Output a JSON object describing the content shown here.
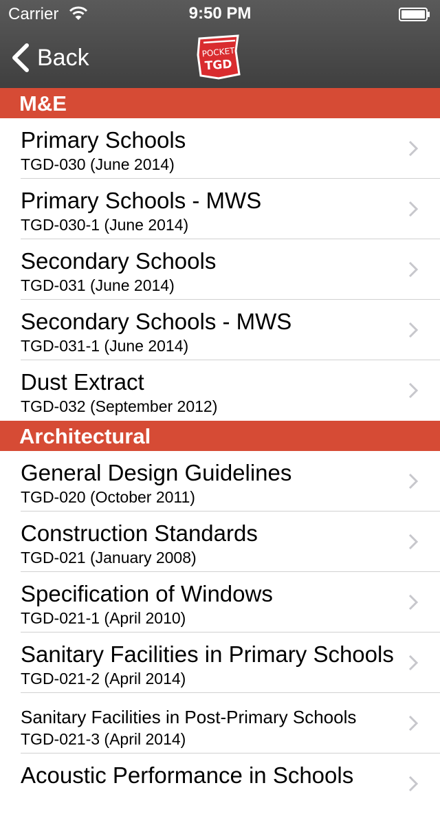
{
  "status": {
    "carrier": "Carrier",
    "time": "9:50 PM"
  },
  "nav": {
    "back_label": "Back",
    "logo_text_1": "POCKET",
    "logo_text_2": "TGD"
  },
  "colors": {
    "accent": "#d64b35",
    "navbar": "#4f4f4f"
  },
  "sections": [
    {
      "header": "M&E",
      "items": [
        {
          "title": "Primary Schools",
          "subtitle": "TGD-030 (June 2014)"
        },
        {
          "title": "Primary Schools - MWS",
          "subtitle": "TGD-030-1 (June 2014)"
        },
        {
          "title": "Secondary Schools",
          "subtitle": "TGD-031 (June 2014)"
        },
        {
          "title": "Secondary Schools - MWS",
          "subtitle": "TGD-031-1 (June 2014)"
        },
        {
          "title": "Dust Extract",
          "subtitle": "TGD-032 (September 2012)"
        }
      ]
    },
    {
      "header": "Architectural",
      "items": [
        {
          "title": "General Design Guidelines",
          "subtitle": "TGD-020 (October 2011)"
        },
        {
          "title": "Construction Standards",
          "subtitle": "TGD-021 (January 2008)"
        },
        {
          "title": "Specification of Windows",
          "subtitle": "TGD-021-1 (April 2010)"
        },
        {
          "title": "Sanitary Facilities in Primary Schools",
          "subtitle": "TGD-021-2 (April 2014)"
        },
        {
          "title": "Sanitary Facilities in Post-Primary Schools",
          "subtitle": "TGD-021-3 (April 2014)"
        },
        {
          "title": "Acoustic Performance in Schools",
          "subtitle": ""
        }
      ]
    }
  ]
}
